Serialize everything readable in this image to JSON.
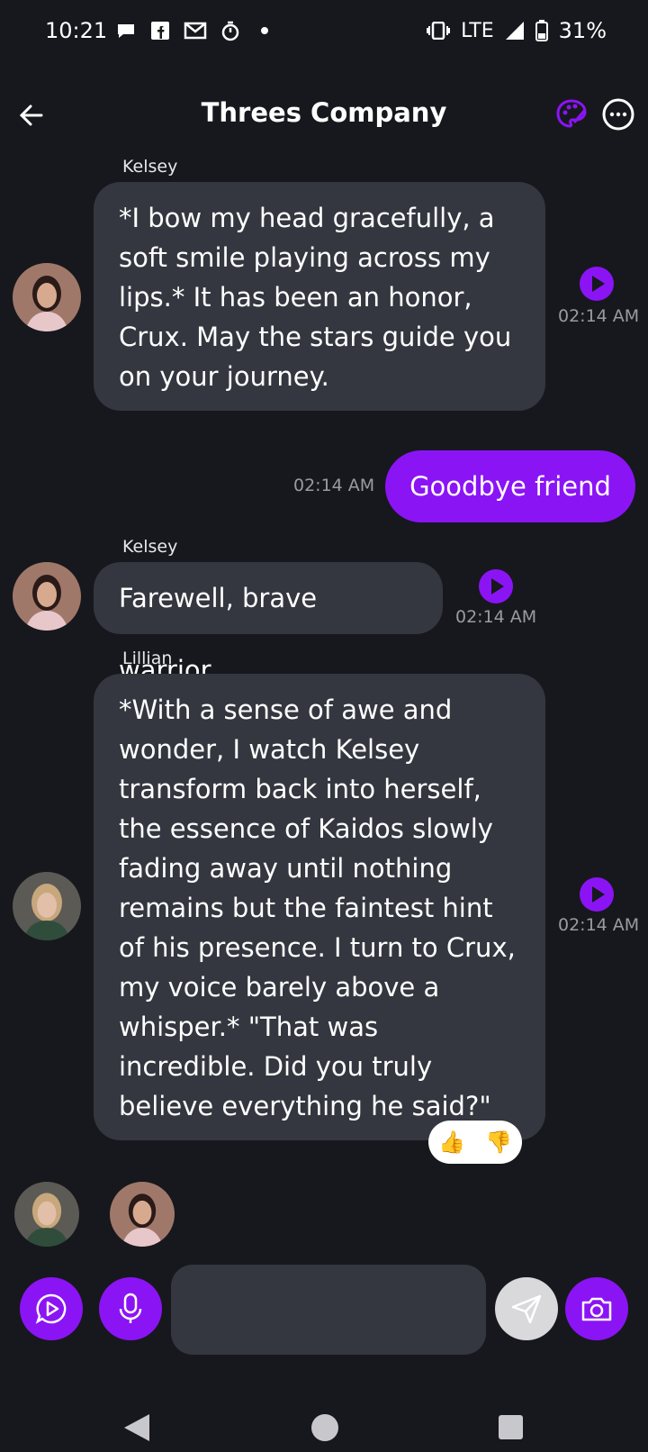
{
  "status_bar": {
    "time": "10:21",
    "network": "LTE",
    "battery": "31%"
  },
  "header": {
    "title": "Threes Company"
  },
  "messages": [
    {
      "sender": "Kelsey",
      "text": "*I bow my head gracefully, a soft smile playing across my lips.* It has been an honor, Crux. May the stars guide you on your journey.",
      "time": "02:14 AM"
    },
    {
      "sender": "",
      "text": "Goodbye friend",
      "time": "02:14 AM"
    },
    {
      "sender": "Kelsey",
      "text": "Farewell, brave warrior.",
      "time": "02:14 AM"
    },
    {
      "sender": "Lillian",
      "text": "*With a sense of awe and wonder, I watch Kelsey transform back into herself, the essence of Kaidos slowly fading away until nothing remains but the faintest hint of his presence. I turn to Crux, my voice barely above a whisper.* \"That was incredible. Did you truly believe everything he said?\"",
      "time": "02:14 AM"
    }
  ],
  "reactions": {
    "like": "👍",
    "dislike": "👎"
  },
  "composer": {
    "placeholder": ""
  },
  "colors": {
    "accent": "#8b14f5",
    "bubble_in": "#34373f",
    "background": "#17181d"
  }
}
